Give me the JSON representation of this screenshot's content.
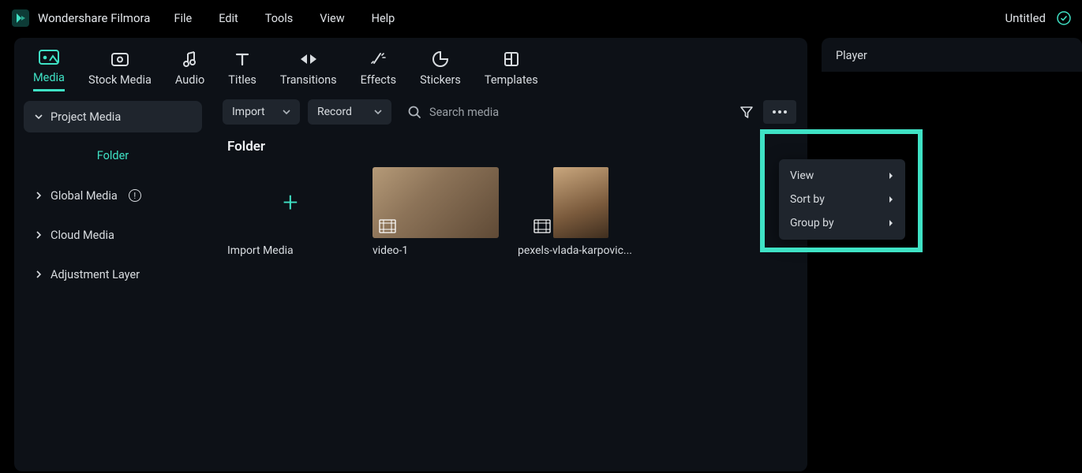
{
  "app_name": "Wondershare Filmora",
  "menubar": {
    "file": "File",
    "edit": "Edit",
    "tools": "Tools",
    "view": "View",
    "help": "Help"
  },
  "doc_title": "Untitled",
  "tabs": {
    "media": "Media",
    "stock": "Stock Media",
    "audio": "Audio",
    "titles": "Titles",
    "transitions": "Transitions",
    "effects": "Effects",
    "stickers": "Stickers",
    "templates": "Templates"
  },
  "sidebar": {
    "project": "Project Media",
    "folder": "Folder",
    "global": "Global Media",
    "cloud": "Cloud Media",
    "adjust": "Adjustment Layer"
  },
  "toolbar": {
    "import": "Import",
    "record": "Record",
    "search_placeholder": "Search media"
  },
  "folder_heading": "Folder",
  "tiles": {
    "import": "Import Media",
    "v1": "video-1",
    "v2": "pexels-vlada-karpovic..."
  },
  "context_menu": {
    "view": "View",
    "sort": "Sort by",
    "group": "Group by"
  },
  "player_label": "Player"
}
